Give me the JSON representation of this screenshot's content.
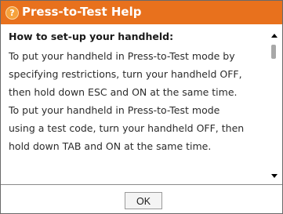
{
  "dialog": {
    "title": "Press-to-Test Help",
    "title_icon": "?",
    "colors": {
      "titlebar": "#e8711d",
      "title_text": "#ffffff"
    }
  },
  "content": {
    "heading": "How to set-up your handheld:",
    "lines": [
      "To put your handheld in Press-to-Test mode by",
      "specifying restrictions, turn your handheld OFF,",
      "then hold down ESC and ON at the same time.",
      "To put your handheld in Press-to-Test mode",
      "using a test code, turn your handheld OFF, then",
      "hold down TAB and ON at the same time."
    ]
  },
  "footer": {
    "ok_label": "OK"
  }
}
